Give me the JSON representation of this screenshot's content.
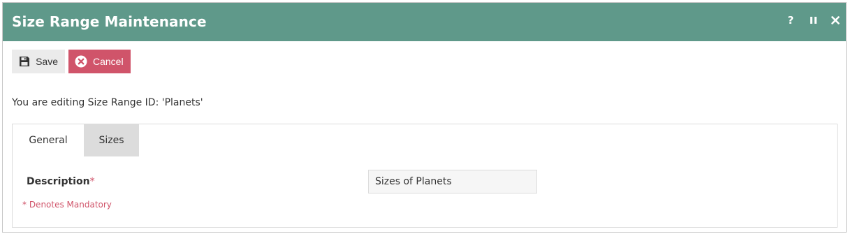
{
  "window": {
    "title": "Size Range Maintenance",
    "controls": {
      "help_glyph": "?",
      "help_icon": "help-icon",
      "pause_icon": "pause-icon",
      "close_icon": "close-icon"
    }
  },
  "toolbar": {
    "save_label": "Save",
    "save_icon": "floppy-disk-icon",
    "cancel_label": "Cancel",
    "cancel_icon": "cancel-circle-icon"
  },
  "edit_message": "You are editing Size Range ID: 'Planets'",
  "tabs": [
    {
      "label": "General",
      "active": true
    },
    {
      "label": "Sizes",
      "active": false
    }
  ],
  "form": {
    "description": {
      "label": "Description",
      "required_marker": "*",
      "value": "Sizes of Planets"
    },
    "mandatory_note": "* Denotes Mandatory"
  },
  "colors": {
    "titlebar": "#5f998a",
    "cancel": "#d0546a",
    "save_bg": "#ebebeb",
    "inactive_tab": "#dcdcdc",
    "required": "#d0546a"
  }
}
